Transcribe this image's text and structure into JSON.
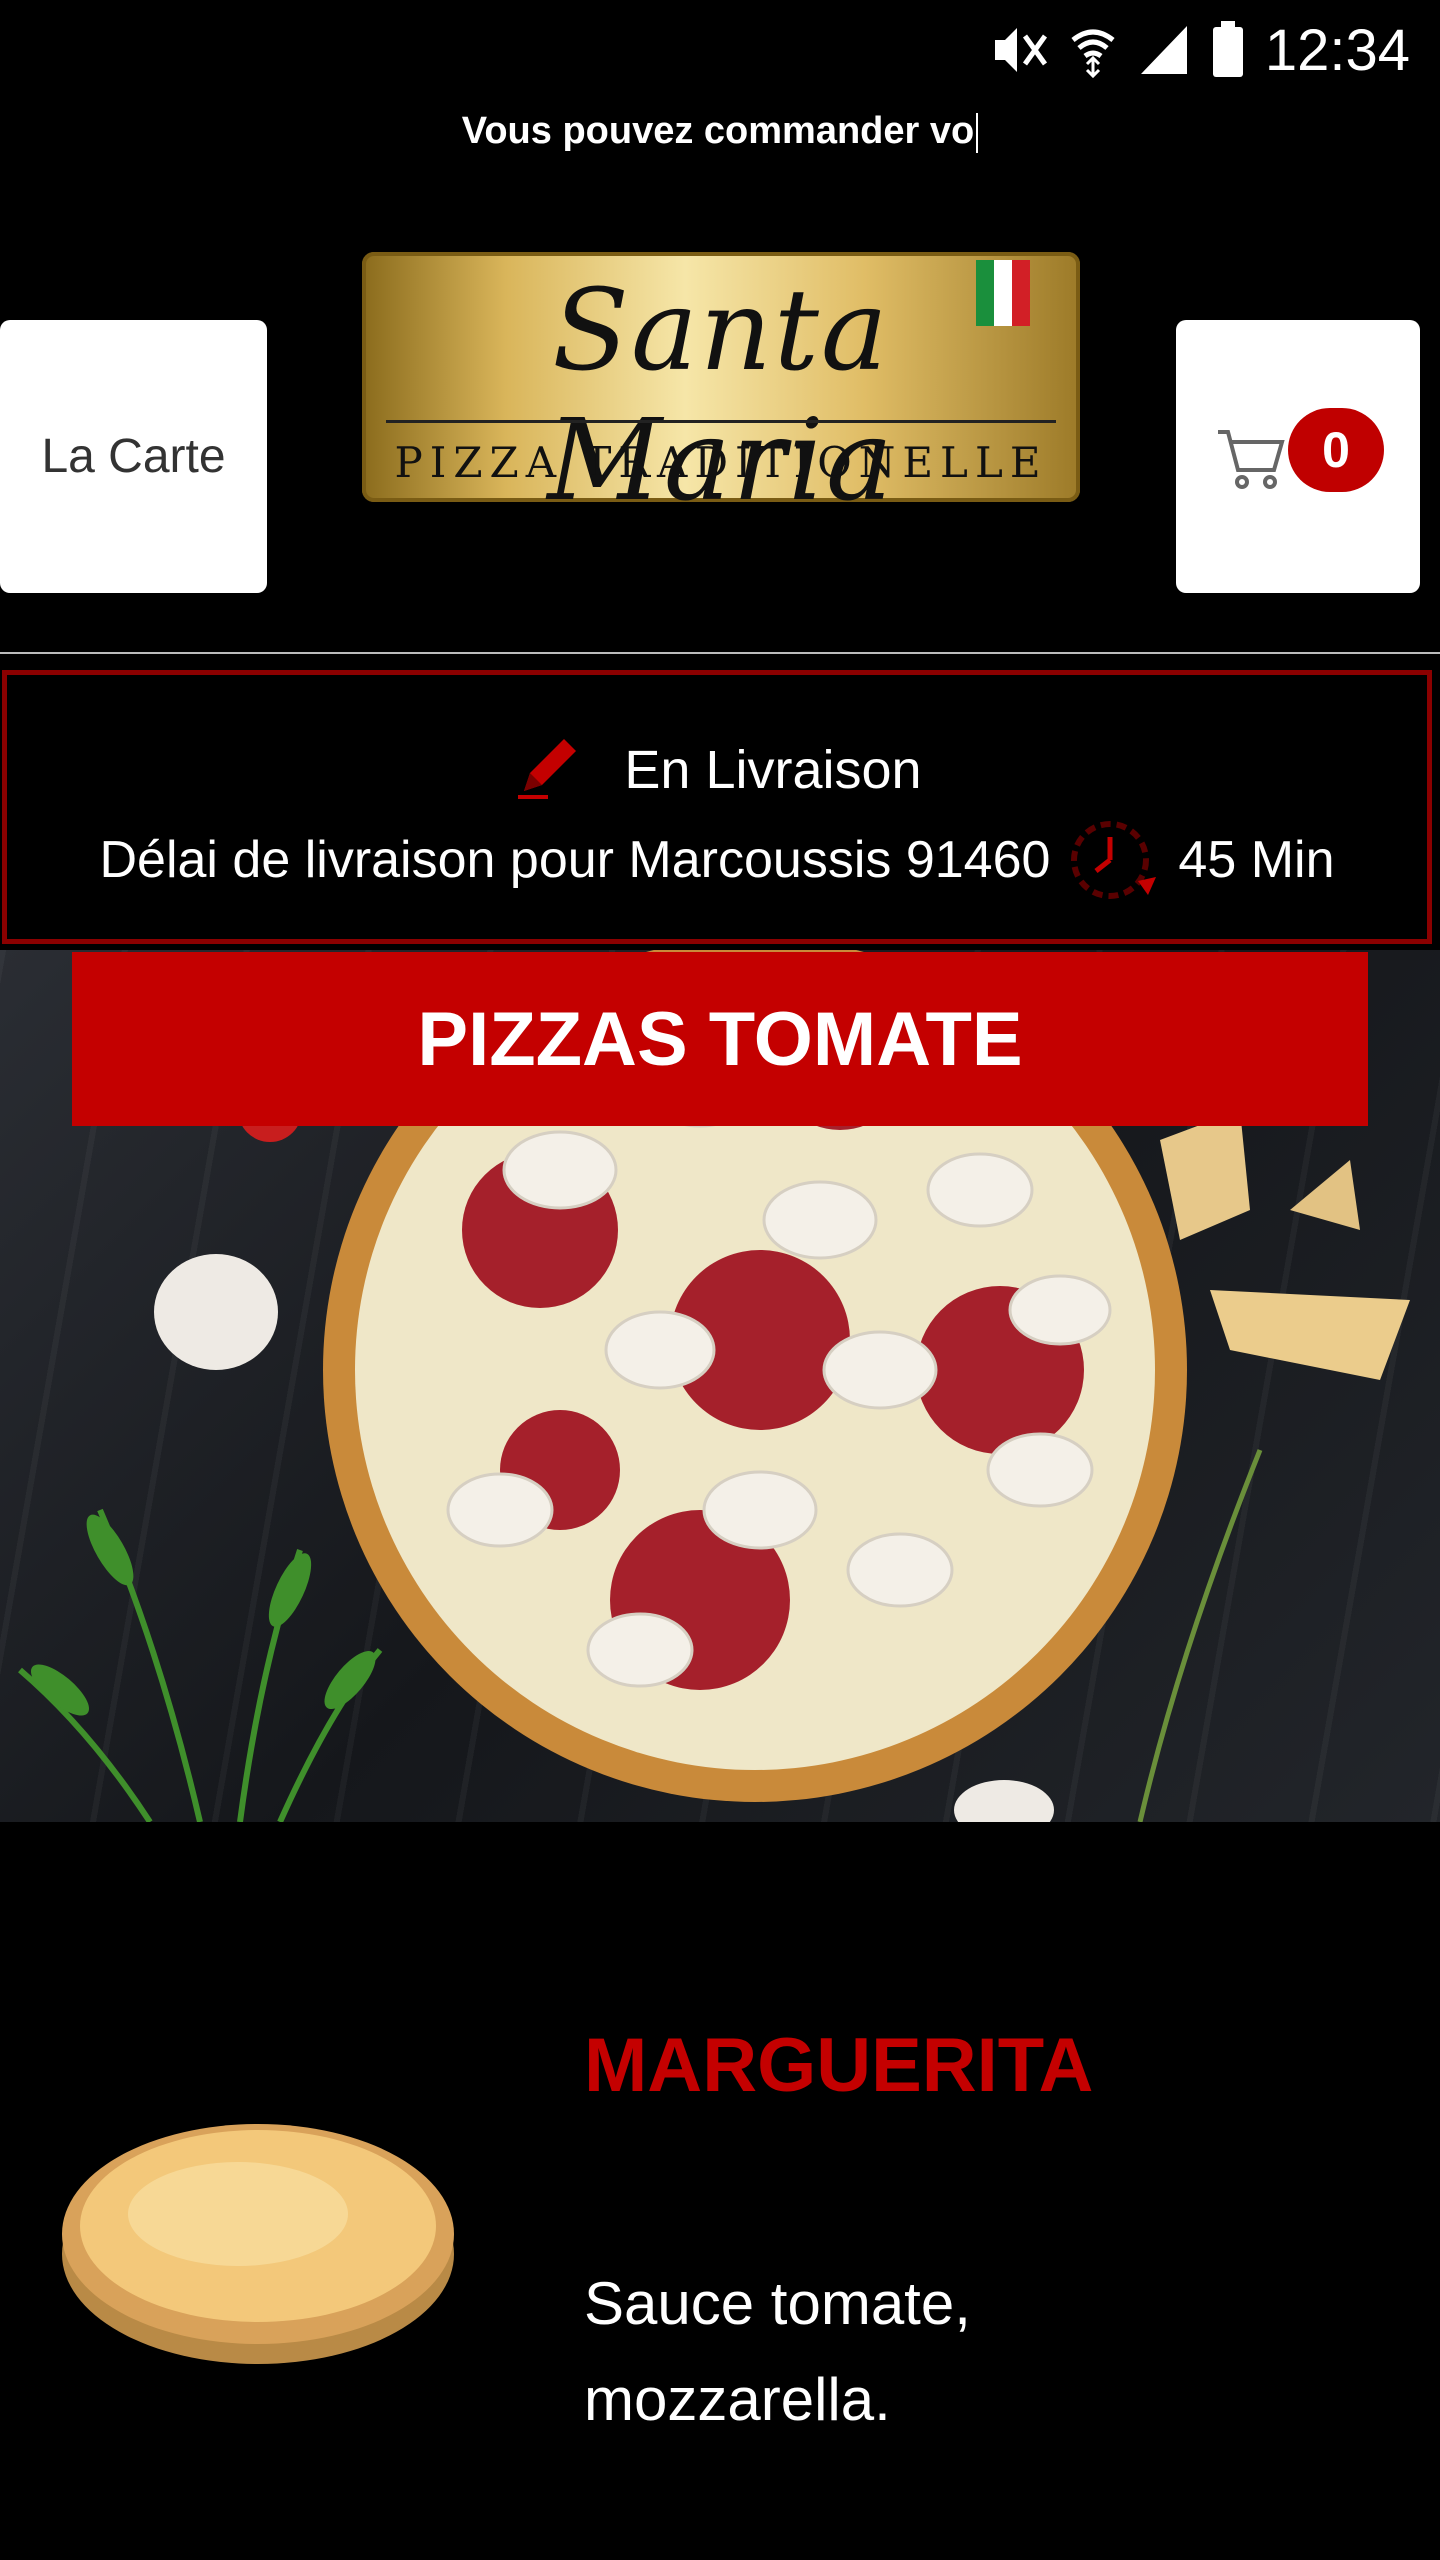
{
  "status_bar": {
    "time": "12:34",
    "icons": [
      "mute-vibrate-icon",
      "wifi-icon",
      "signal-icon",
      "battery-icon"
    ]
  },
  "ticker": {
    "text": "Vous pouvez commander vo"
  },
  "header": {
    "menu_button_label": "La Carte",
    "cart_count": "0",
    "logo": {
      "script_text": "Santa Maria",
      "subtitle": "PIZZA TRADITIONELLE"
    }
  },
  "delivery": {
    "mode": "En Livraison",
    "delay_text": "Délai de livraison pour Marcoussis 91460",
    "delay_value": "45 Min"
  },
  "category": {
    "title": "PIZZAS TOMATE"
  },
  "product": {
    "name": "MARGUERITA",
    "description": "Sauce tomate, mozzarella."
  },
  "colors": {
    "accent": "#c40000",
    "background": "#000000",
    "border": "#8b0000"
  }
}
